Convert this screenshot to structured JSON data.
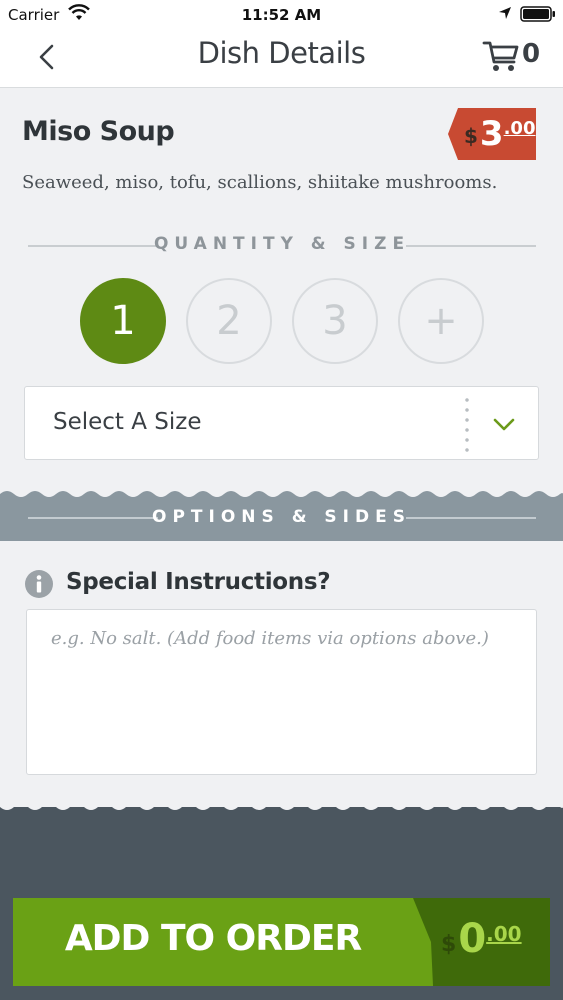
{
  "status_bar": {
    "carrier": "Carrier",
    "time": "11:52 AM"
  },
  "nav": {
    "title": "Dish Details",
    "cart_count": "0",
    "icons": [
      "back-chevron-icon",
      "cart-icon"
    ]
  },
  "dish": {
    "name": "Miso Soup",
    "description": "Seaweed, miso, tofu, scallions, shiitake mushrooms.",
    "price": {
      "currency": "$",
      "main": "3",
      "cents": ".00"
    }
  },
  "quantity": {
    "section_label": "QUANTITY & SIZE",
    "options": [
      "1",
      "2",
      "3",
      "+"
    ],
    "selected": "1"
  },
  "size": {
    "label": "Select A Size"
  },
  "options_section": {
    "label": "OPTIONS & SIDES"
  },
  "instructions": {
    "title": "Special Instructions?",
    "placeholder": "e.g. No salt. (Add food items via options above.)",
    "value": ""
  },
  "order": {
    "button_label": "ADD TO ORDER",
    "total": {
      "currency": "$",
      "main": "0",
      "cents": ".00"
    }
  },
  "colors": {
    "accent_green": "#5e8a14",
    "price_red": "#c84a32",
    "band_gray": "#8a979f",
    "footer_dark": "#4b565f"
  }
}
